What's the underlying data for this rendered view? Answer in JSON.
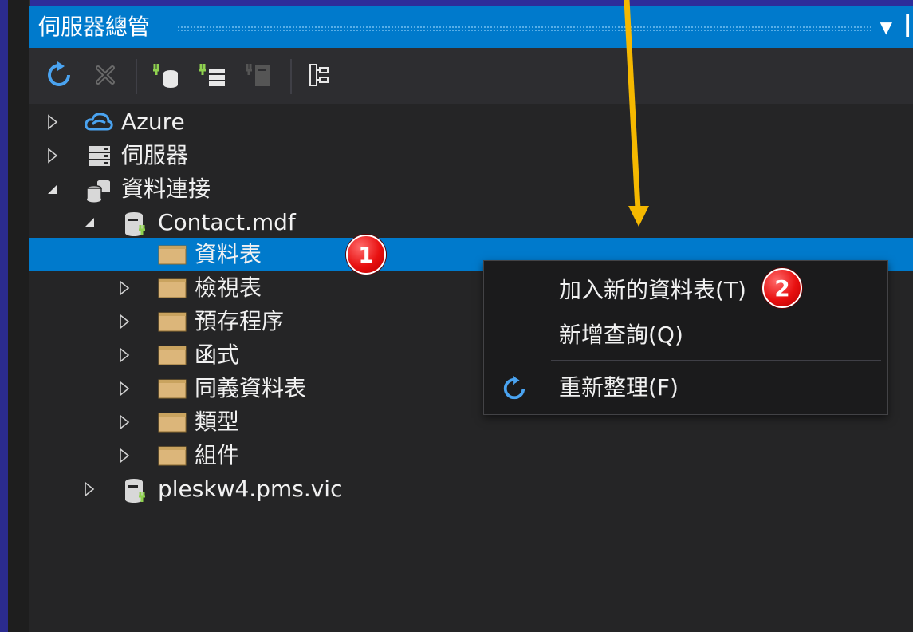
{
  "window": {
    "title": "伺服器總管"
  },
  "toolbar": {
    "buttons": [
      {
        "icon": "refresh-icon"
      },
      {
        "icon": "stop-icon"
      },
      {
        "icon": "connect-database-icon"
      },
      {
        "icon": "connect-server-icon"
      },
      {
        "icon": "connect-sharepoint-icon"
      },
      {
        "icon": "show-designer-icon"
      }
    ]
  },
  "tree": {
    "items": [
      {
        "label": "Azure",
        "icon": "azure-cloud-icon",
        "state": "collapsed"
      },
      {
        "label": "伺服器",
        "icon": "server-icon",
        "state": "collapsed"
      },
      {
        "label": "資料連接",
        "icon": "data-connections-icon",
        "state": "expanded"
      },
      {
        "label": "Contact.mdf",
        "icon": "database-icon",
        "state": "expanded"
      },
      {
        "label": "資料表",
        "icon": "folder-icon",
        "state": "none",
        "selected": true
      },
      {
        "label": "檢視表",
        "icon": "folder-icon",
        "state": "collapsed"
      },
      {
        "label": "預存程序",
        "icon": "folder-icon",
        "state": "collapsed"
      },
      {
        "label": "函式",
        "icon": "folder-icon",
        "state": "collapsed"
      },
      {
        "label": "同義資料表",
        "icon": "folder-icon",
        "state": "collapsed"
      },
      {
        "label": "類型",
        "icon": "folder-icon",
        "state": "collapsed"
      },
      {
        "label": "組件",
        "icon": "folder-icon",
        "state": "collapsed"
      },
      {
        "label": "pleskw4.pms.vic",
        "icon": "database-icon",
        "state": "collapsed"
      }
    ]
  },
  "context_menu": {
    "items": [
      {
        "label": "加入新的資料表(T)"
      },
      {
        "label": "新增查詢(Q)"
      },
      {
        "label": "重新整理(F)",
        "icon": "refresh-icon"
      }
    ]
  },
  "annotations": {
    "step1": "1",
    "step2": "2"
  },
  "colors": {
    "accent": "#007acc",
    "background": "#252526",
    "toolbar": "#2d2d30",
    "menu": "#1b1b1c",
    "arrow": "#f5b800",
    "badge": "#e81010"
  }
}
